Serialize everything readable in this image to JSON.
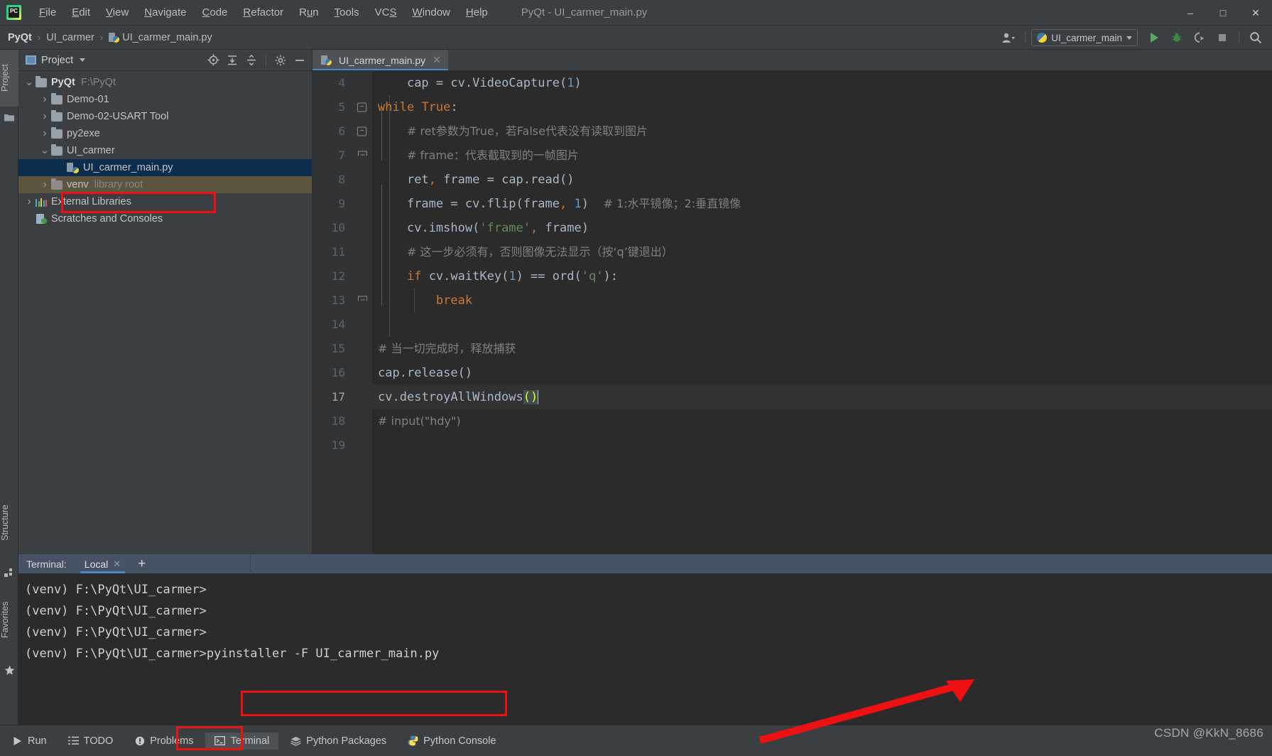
{
  "window": {
    "title": "PyQt - UI_carmer_main.py",
    "minimize": "–",
    "maximize": "□",
    "close": "✕"
  },
  "menubar": [
    {
      "label": "File",
      "accel": "F"
    },
    {
      "label": "Edit",
      "accel": "E"
    },
    {
      "label": "View",
      "accel": "V"
    },
    {
      "label": "Navigate",
      "accel": "N"
    },
    {
      "label": "Code",
      "accel": "C"
    },
    {
      "label": "Refactor",
      "accel": "R"
    },
    {
      "label": "Run",
      "accel": "u"
    },
    {
      "label": "Tools",
      "accel": "T"
    },
    {
      "label": "VCS",
      "accel": "S"
    },
    {
      "label": "Window",
      "accel": "W"
    },
    {
      "label": "Help",
      "accel": "H"
    }
  ],
  "breadcrumb": {
    "root": "PyQt",
    "folder": "UI_carmer",
    "file": "UI_carmer_main.py",
    "separator": "›"
  },
  "toolbar": {
    "run_config": "UI_carmer_main",
    "run_tooltip": "Run",
    "debug_tooltip": "Debug",
    "coverage_tooltip": "Run with Coverage",
    "stop_tooltip": "Stop",
    "search_tooltip": "Search Everywhere"
  },
  "left_strip": {
    "project_tab": "Project",
    "structure_tab": "Structure",
    "favorites_tab": "Favorites"
  },
  "project_panel": {
    "title": "Project",
    "tree": [
      {
        "label": "PyQt",
        "sub": "F:\\PyQt",
        "depth": 0,
        "twist": "v",
        "icon": "folder",
        "bold": true,
        "state": "normal"
      },
      {
        "label": "Demo-01",
        "sub": "",
        "depth": 1,
        "twist": ">",
        "icon": "folder",
        "bold": false,
        "state": "normal"
      },
      {
        "label": "Demo-02-USART Tool",
        "sub": "",
        "depth": 1,
        "twist": ">",
        "icon": "folder",
        "bold": false,
        "state": "normal"
      },
      {
        "label": "py2exe",
        "sub": "",
        "depth": 1,
        "twist": ">",
        "icon": "folder",
        "bold": false,
        "state": "normal"
      },
      {
        "label": "UI_carmer",
        "sub": "",
        "depth": 1,
        "twist": "v",
        "icon": "folder",
        "bold": false,
        "state": "normal"
      },
      {
        "label": "UI_carmer_main.py",
        "sub": "",
        "depth": 2,
        "twist": "",
        "icon": "python-file",
        "bold": false,
        "state": "selected"
      },
      {
        "label": "venv",
        "sub": "library root",
        "depth": 1,
        "twist": ">",
        "icon": "folder-dim",
        "bold": false,
        "state": "venv"
      },
      {
        "label": "External Libraries",
        "sub": "",
        "depth": 0,
        "twist": ">",
        "icon": "libraries",
        "bold": false,
        "state": "normal"
      },
      {
        "label": "Scratches and Consoles",
        "sub": "",
        "depth": 0,
        "twist": "",
        "icon": "scratches",
        "bold": false,
        "state": "normal"
      }
    ]
  },
  "editor": {
    "tab_name": "UI_carmer_main.py",
    "tab_close": "✕",
    "current_line": 17,
    "lines": [
      {
        "no": "4",
        "fold": "",
        "text": "    cap = cv.VideoCapture(1)"
      },
      {
        "no": "5",
        "fold": "top",
        "text": "while True:"
      },
      {
        "no": "6",
        "fold": "mid",
        "text": "    # ret参数为True，若False代表没有读取到图片"
      },
      {
        "no": "7",
        "fold": "end",
        "text": "    # frame：代表截取到的一帧图片"
      },
      {
        "no": "8",
        "fold": "",
        "text": "    ret, frame = cap.read()"
      },
      {
        "no": "9",
        "fold": "",
        "text": "    frame = cv.flip(frame, 1)  # 1:水平镜像；2:垂直镜像"
      },
      {
        "no": "10",
        "fold": "",
        "text": "    cv.imshow('frame', frame)"
      },
      {
        "no": "11",
        "fold": "",
        "text": "    # 这一步必须有，否则图像无法显示（按‘q’键退出）"
      },
      {
        "no": "12",
        "fold": "",
        "text": "    if cv.waitKey(1) == ord('q'):"
      },
      {
        "no": "13",
        "fold": "end",
        "text": "        break"
      },
      {
        "no": "14",
        "fold": "",
        "text": ""
      },
      {
        "no": "15",
        "fold": "",
        "text": "# 当一切完成时，释放捕获"
      },
      {
        "no": "16",
        "fold": "",
        "text": "cap.release()"
      },
      {
        "no": "17",
        "fold": "",
        "text": "cv.destroyAllWindows()"
      },
      {
        "no": "18",
        "fold": "",
        "text": "# input(\"hdy\")"
      },
      {
        "no": "19",
        "fold": "",
        "text": ""
      }
    ]
  },
  "terminal": {
    "label": "Terminal:",
    "tab": "Local",
    "tab_close": "✕",
    "add_tab": "+",
    "lines": [
      {
        "prompt": "(venv) F:\\PyQt\\UI_carmer>",
        "command": ""
      },
      {
        "prompt": "(venv) F:\\PyQt\\UI_carmer>",
        "command": ""
      },
      {
        "prompt": "(venv) F:\\PyQt\\UI_carmer>",
        "command": ""
      },
      {
        "prompt": "(venv) F:\\PyQt\\UI_carmer>",
        "command": "pyinstaller -F UI_carmer_main.py"
      }
    ]
  },
  "statusbar": {
    "buttons": [
      {
        "label": "Run",
        "icon": "run-icon",
        "active": false
      },
      {
        "label": "TODO",
        "icon": "todo-icon",
        "active": false
      },
      {
        "label": "Problems",
        "icon": "problems-icon",
        "active": false
      },
      {
        "label": "Terminal",
        "icon": "terminal-icon",
        "active": true
      },
      {
        "label": "Python Packages",
        "icon": "packages-icon",
        "active": false
      },
      {
        "label": "Python Console",
        "icon": "python-console-icon",
        "active": false
      }
    ],
    "watermark": "CSDN @KkN_8686"
  },
  "colors": {
    "accent_blue": "#4a88c7",
    "selection_blue": "#0d2d4e",
    "venv_olive": "#5c5540",
    "annotation_red": "#ee1111",
    "keyword_orange": "#cc7832",
    "string_green": "#6a8759",
    "number_blue": "#6897bb",
    "function_yellow": "#ffc66d",
    "comment_gray": "#808080",
    "plain_text": "#a9b7c6",
    "editor_bg": "#2b2b2b",
    "panel_bg": "#3c3f41"
  }
}
